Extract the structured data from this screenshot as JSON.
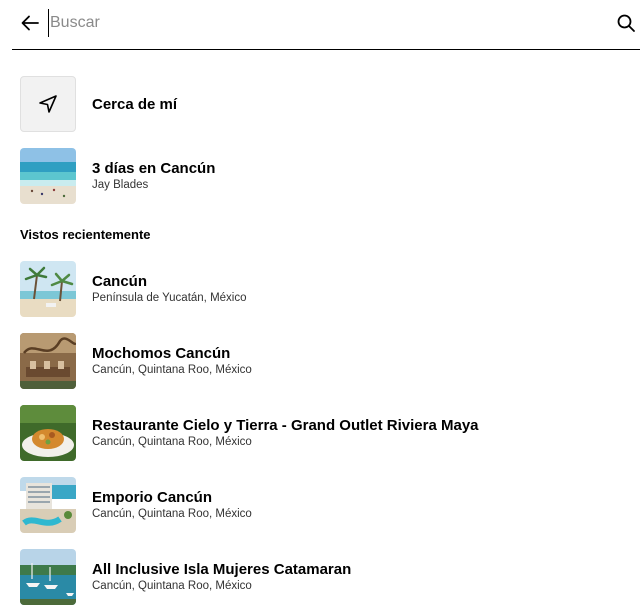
{
  "search": {
    "placeholder": "Buscar",
    "value": ""
  },
  "near_me": {
    "label": "Cerca de mí",
    "icon": "navigation-arrow-icon"
  },
  "featured": {
    "title": "3 días en Cancún",
    "subtitle": "Jay Blades"
  },
  "recent": {
    "heading": "Vistos recientemente",
    "items": [
      {
        "title": "Cancún",
        "subtitle": "Península de Yucatán, México"
      },
      {
        "title": "Mochomos Cancún",
        "subtitle": "Cancún, Quintana Roo, México"
      },
      {
        "title": "Restaurante Cielo y Tierra - Grand Outlet Riviera Maya",
        "subtitle": "Cancún, Quintana Roo, México"
      },
      {
        "title": "Emporio Cancún",
        "subtitle": "Cancún, Quintana Roo, México"
      },
      {
        "title": "All Inclusive Isla Mujeres Catamaran",
        "subtitle": "Cancún, Quintana Roo, México"
      }
    ]
  },
  "icons": {
    "back": "arrow-left-icon",
    "search": "magnifier-icon"
  }
}
